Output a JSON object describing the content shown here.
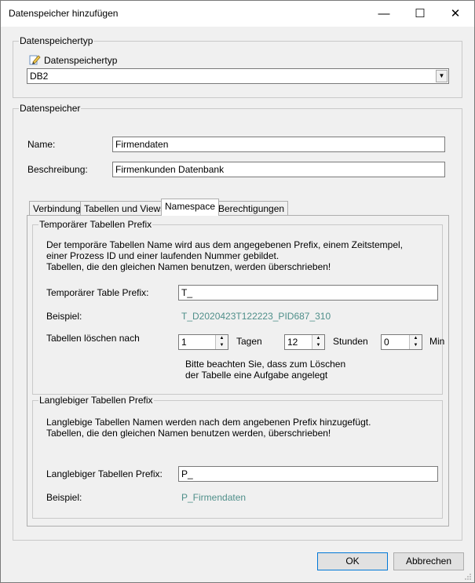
{
  "window": {
    "title": "Datenspeicher hinzufügen",
    "minimize_glyph": "—",
    "maximize_glyph": "☐",
    "close_glyph": "✕"
  },
  "type_group": {
    "legend": "Datenspeichertyp",
    "label": "Datenspeichertyp",
    "icon": "edit-pencil-icon",
    "selected_value": "DB2"
  },
  "store_group": {
    "legend": "Datenspeicher",
    "name_label": "Name:",
    "name_value": "Firmendaten",
    "description_label": "Beschreibung:",
    "description_value": "Firmenkunden Datenbank"
  },
  "tabs": [
    {
      "label": "Verbindung",
      "active": false
    },
    {
      "label": "Tabellen und Views",
      "active": false
    },
    {
      "label": "Namespace",
      "active": true
    },
    {
      "label": "Berechtigungen",
      "active": false
    }
  ],
  "temp_prefix": {
    "legend": "Temporärer Tabellen Prefix",
    "info_lines": [
      "Der temporäre Tabellen Name wird aus dem angegebenen Prefix, einem Zeitstempel,",
      "einer Prozess ID und einer laufenden Nummer gebildet.",
      "Tabellen, die den gleichen Namen benutzen, werden überschrieben!"
    ],
    "prefix_label": "Temporärer Table Prefix:",
    "prefix_value": "T_",
    "example_label": "Beispiel:",
    "example_value": "T_D2020423T122223_PID687_310",
    "delete_after_label": "Tabellen löschen nach",
    "days_value": "1",
    "days_unit": "Tagen",
    "hours_value": "12",
    "hours_unit": "Stunden",
    "minutes_value": "0",
    "minutes_unit": "Min",
    "note_lines": [
      "Bitte beachten Sie, dass zum Löschen",
      "der Tabelle eine Aufgabe angelegt"
    ]
  },
  "persistent_prefix": {
    "legend": "Langlebiger Tabellen Prefix",
    "info_lines": [
      "Langlebige Tabellen Namen werden nach dem angebenen Prefix hinzugefügt.",
      "Tabellen, die den gleichen Namen benutzen werden, überschrieben!"
    ],
    "prefix_label": "Langlebiger Tabellen Prefix:",
    "prefix_value": "P_",
    "example_label": "Beispiel:",
    "example_value": "P_Firmendaten"
  },
  "buttons": {
    "ok": "OK",
    "cancel": "Abbrechen"
  },
  "colors": {
    "example_link": "#4f8f8a",
    "default_button_border": "#0078d7",
    "window_bg": "#f0f0f0"
  }
}
